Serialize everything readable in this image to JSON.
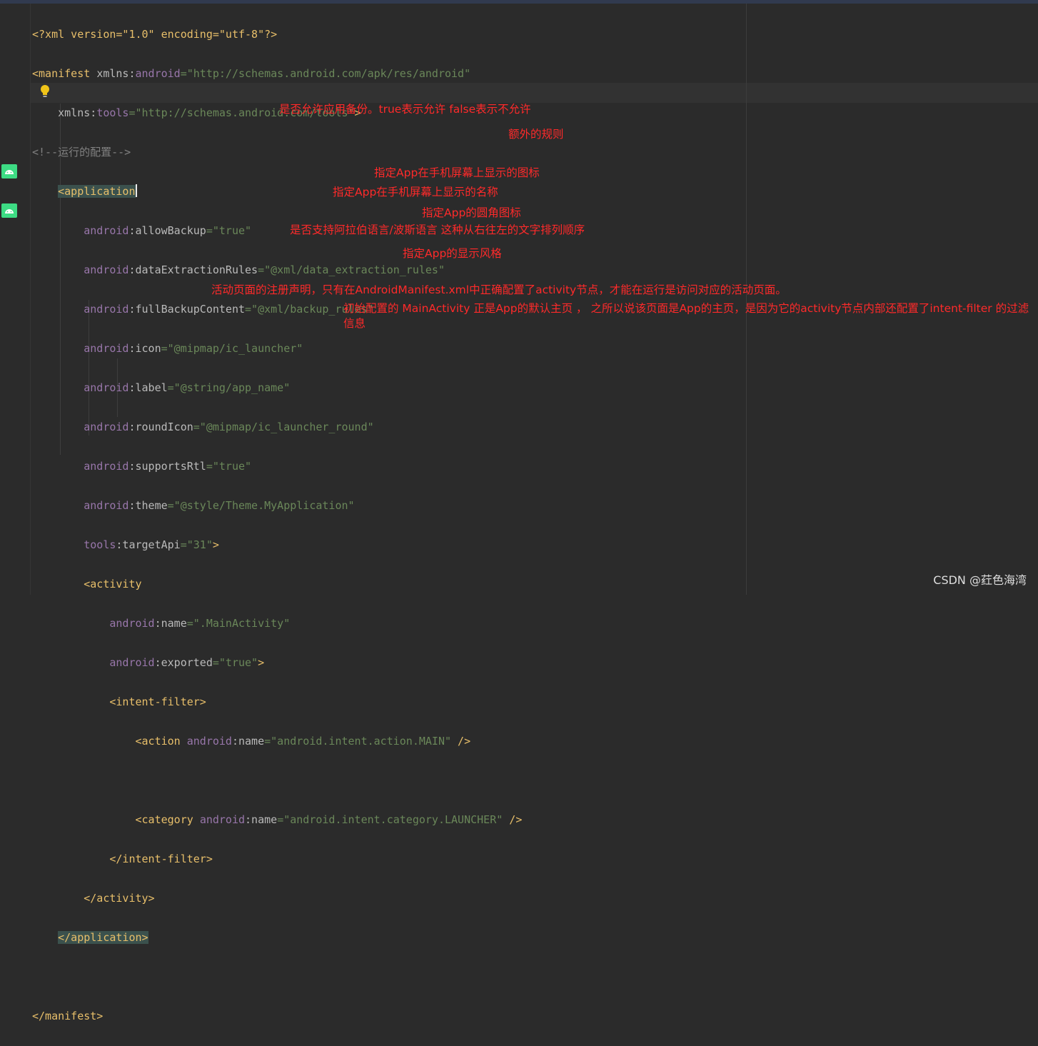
{
  "code": {
    "xml_decl": "<?xml version=\"1.0\" encoding=\"utf-8\"?>",
    "manifest_open": "<manifest",
    "xmlns_android_attr": "xmlns:",
    "xmlns_android_ns": "android",
    "xmlns_android_val": "=\"http://schemas.android.com/apk/res/android\"",
    "xmlns_tools_attr": "xmlns:",
    "xmlns_tools_ns": "tools",
    "xmlns_tools_val": "=\"http://schemas.android.com/tools\"",
    "xmlns_close": ">",
    "comment": "<!--运行的配置-->",
    "application_open": "<application",
    "app_attrs": [
      {
        "ns": "android",
        "name": ":allowBackup",
        "value": "=\"true\""
      },
      {
        "ns": "android",
        "name": ":dataExtractionRules",
        "value": "=\"@xml/data_extraction_rules\""
      },
      {
        "ns": "android",
        "name": ":fullBackupContent",
        "value": "=\"@xml/backup_rules\""
      },
      {
        "ns": "android",
        "name": ":icon",
        "value": "=\"@mipmap/ic_launcher\""
      },
      {
        "ns": "android",
        "name": ":label",
        "value": "=\"@string/app_name\""
      },
      {
        "ns": "android",
        "name": ":roundIcon",
        "value": "=\"@mipmap/ic_launcher_round\""
      },
      {
        "ns": "android",
        "name": ":supportsRtl",
        "value": "=\"true\""
      },
      {
        "ns": "android",
        "name": ":theme",
        "value": "=\"@style/Theme.MyApplication\""
      }
    ],
    "target_api": {
      "ns": "tools",
      "name": ":targetApi",
      "value": "=\"31\"",
      "close": ">"
    },
    "activity_open": "<activity",
    "activity_name": {
      "ns": "android",
      "name": ":name",
      "value": "=\".MainActivity\""
    },
    "activity_exported": {
      "ns": "android",
      "name": ":exported",
      "value": "=\"true\"",
      "close": ">"
    },
    "intent_filter_open": "<intent-filter>",
    "action": {
      "tag": "<action",
      "ns": "android",
      "name": ":name",
      "value": "=\"android.intent.action.MAIN\"",
      "close": " />"
    },
    "category": {
      "tag": "<category",
      "ns": "android",
      "name": ":name",
      "value": "=\"android.intent.category.LAUNCHER\"",
      "close": " />"
    },
    "intent_filter_close": "</intent-filter>",
    "activity_close": "</activity>",
    "application_close": "</application>",
    "manifest_close": "</manifest>"
  },
  "annotations": {
    "allow_backup": "是否允许应用备份。true表示允许 false表示不允许",
    "extraction_rules": "额外的规则",
    "icon": "指定App在手机屏幕上显示的图标",
    "label": "指定App在手机屏幕上显示的名称",
    "round_icon": "指定App的圆角图标",
    "supports_rtl": "是否支持阿拉伯语言/波斯语言 这种从右往左的文字排列顺序",
    "theme": "指定App的显示风格",
    "activity": "活动页面的注册声明，只有在AndroidManifest.xml中正确配置了activity节点，才能在运行是访问对应的活动页面。",
    "main_activity": "初始配置的 MainActivity 正是App的默认主页 ， 之所以说该页面是App的主页，是因为它的activity节点内部还配置了intent-filter 的过滤信息"
  },
  "watermark": "CSDN @荭色海湾",
  "icons": {
    "gutter": [
      "android-icon",
      "android-icon"
    ],
    "intention": "lightbulb-icon"
  },
  "colors": {
    "background": "#2b2b2b",
    "tag": "#e8bf6a",
    "namespace": "#9876aa",
    "attribute": "#bababa",
    "value": "#6a8759",
    "comment": "#808080",
    "annotation": "#ff2a2a",
    "tag_match_highlight": "#3b514d"
  }
}
